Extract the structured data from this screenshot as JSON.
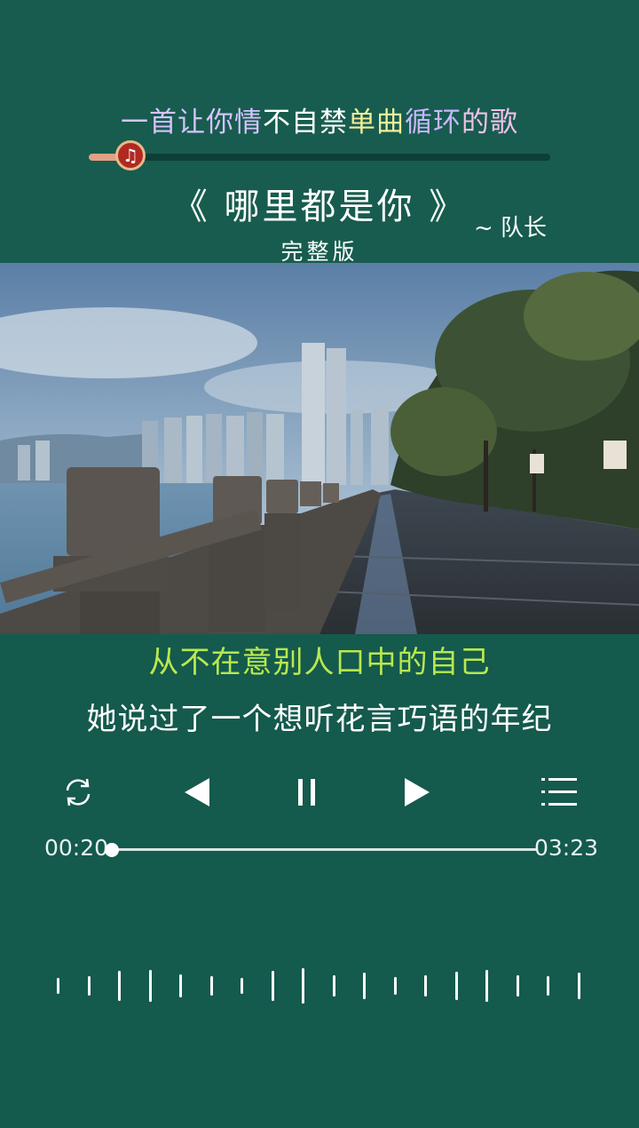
{
  "header": {
    "tagline_segments": [
      {
        "text": "一首让你情",
        "color": "#d7c3ff"
      },
      {
        "text": "不自禁",
        "color": "#ffffff"
      },
      {
        "text": "单曲",
        "color": "#f2ee9a"
      },
      {
        "text": "循环",
        "color": "#c8b6ff"
      },
      {
        "text": "的歌",
        "color": "#f0c0ea"
      }
    ],
    "song_title": "《 哪里都是你 》",
    "artist": "~ 队长",
    "version": "完整版",
    "top_progress": 0.1,
    "music_icon": "music-note-icon"
  },
  "lyrics": {
    "current_line": "从不在意别人口中的自己",
    "next_line": "她说过了一个想听花言巧语的年纪"
  },
  "player": {
    "elapsed": "00:20",
    "total": "03:23",
    "progress": 0.1,
    "controls": [
      "repeat-icon",
      "previous-icon",
      "pause-icon",
      "next-icon",
      "playlist-icon"
    ]
  },
  "colors": {
    "background": "#145a4d",
    "lyric_highlight": "#b9e84e",
    "text": "#ffffff"
  }
}
